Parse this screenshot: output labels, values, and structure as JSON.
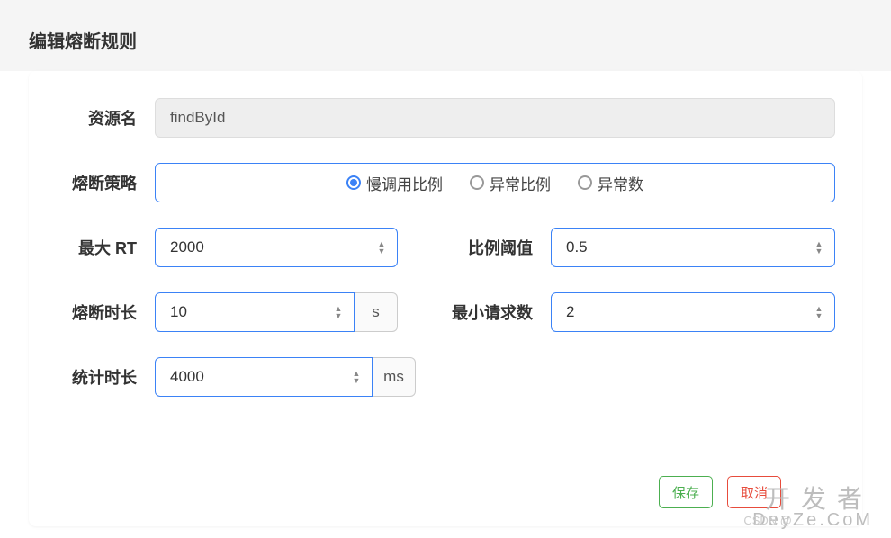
{
  "modal": {
    "title": "编辑熔断规则"
  },
  "form": {
    "resource_label": "资源名",
    "resource_value": "findById",
    "strategy_label": "熔断策略",
    "strategy_options": {
      "slow_ratio": "慢调用比例",
      "error_ratio": "异常比例",
      "error_count": "异常数"
    },
    "max_rt_label": "最大 RT",
    "max_rt_value": "2000",
    "ratio_threshold_label": "比例阈值",
    "ratio_threshold_value": "0.5",
    "break_duration_label": "熔断时长",
    "break_duration_value": "10",
    "break_duration_unit": "s",
    "min_requests_label": "最小请求数",
    "min_requests_value": "2",
    "stat_duration_label": "统计时长",
    "stat_duration_value": "4000",
    "stat_duration_unit": "ms"
  },
  "footer": {
    "save": "保存",
    "cancel": "取消"
  },
  "watermark": {
    "line1": "开发者",
    "line2": "DeyZe.CoM",
    "csdn": "CSDN @"
  }
}
